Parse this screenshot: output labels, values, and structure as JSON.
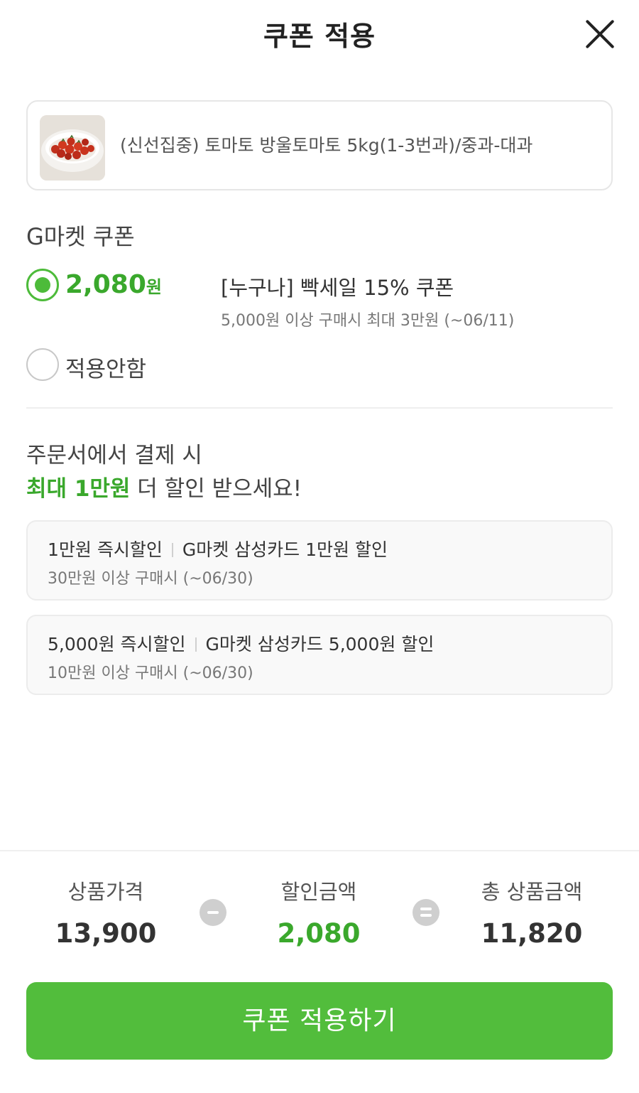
{
  "header": {
    "title": "쿠폰 적용",
    "close_icon": "close-icon"
  },
  "product": {
    "name": "(신선집중) 토마토 방울토마토 5kg(1-3번과)/중과-대과",
    "thumbnail": "tomato-bowl-image"
  },
  "gmarket_coupon": {
    "section_title": "G마켓 쿠폰",
    "options": [
      {
        "amount": "2,080",
        "unit": "원",
        "name": "[누구나] 빡세일 15% 쿠폰",
        "description": "5,000원 이상 구매시 최대 3만원 (~06/11)",
        "selected": true
      }
    ],
    "no_apply_label": "적용안함"
  },
  "promo": {
    "line1": "주문서에서 결제 시",
    "line2_accent": "최대 1만원",
    "line2_rest": " 더 할인 받으세요!"
  },
  "card_offers": [
    {
      "discount": "1만원 즉시할인",
      "card": "G마켓 삼성카드 1만원 할인",
      "condition": "30만원 이상 구매시 (~06/30)"
    },
    {
      "discount": "5,000원 즉시할인",
      "card": "G마켓 삼성카드 5,000원 할인",
      "condition": "10만원 이상 구매시 (~06/30)"
    }
  ],
  "summary": {
    "price_label": "상품가격",
    "price_value": "13,900",
    "discount_label": "할인금액",
    "discount_value": "2,080",
    "total_label": "총 상품금액",
    "total_value": "11,820"
  },
  "apply_button": "쿠폰 적용하기",
  "colors": {
    "accent_green": "#4dbb3a",
    "button_green": "#52bd3c",
    "text_dark": "#222222"
  }
}
